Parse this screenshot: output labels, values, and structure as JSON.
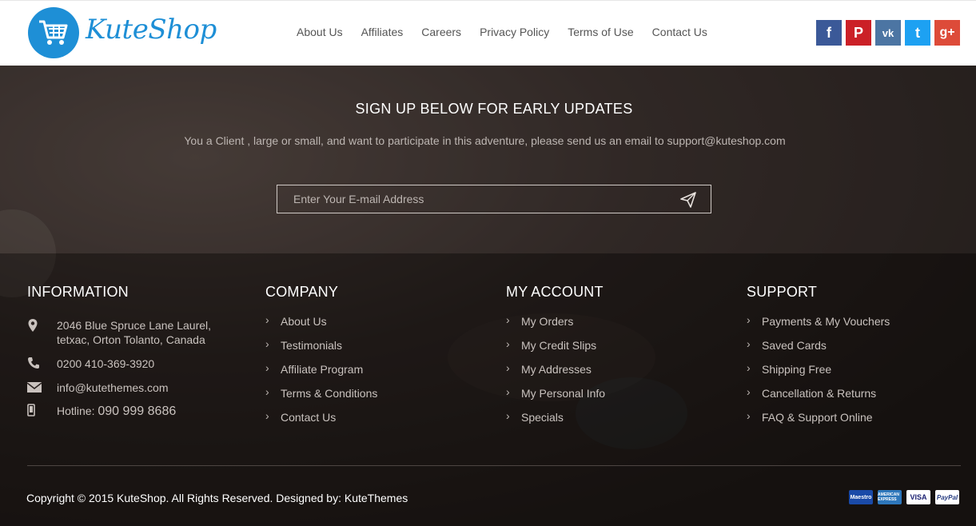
{
  "header": {
    "logo_text": "KuteShop",
    "nav": [
      "About Us",
      "Affiliates",
      "Careers",
      "Privacy Policy",
      "Terms of Use",
      "Contact Us"
    ],
    "social": [
      {
        "icon": "facebook-icon",
        "glyph": "f"
      },
      {
        "icon": "pinterest-icon",
        "glyph": "P"
      },
      {
        "icon": "vk-icon",
        "glyph": "vk"
      },
      {
        "icon": "twitter-icon",
        "glyph": "t"
      },
      {
        "icon": "google-plus-icon",
        "glyph": "g+"
      }
    ]
  },
  "signup": {
    "title": "SIGN UP BELOW FOR EARLY UPDATES",
    "text": "You a Client , large or small, and want to participate in this adventure, please send us an email to support@kuteshop.com",
    "placeholder": "Enter Your E-mail Address"
  },
  "footer": {
    "information": {
      "title": "INFORMATION",
      "address_line1": "2046 Blue Spruce Lane Laurel,",
      "address_line2": "tetxac, Orton Tolanto, Canada",
      "phone": "0200 410-369-3920",
      "email": "info@kutethemes.com",
      "hotline_label": "Hotline:",
      "hotline_number": "090 999 8686"
    },
    "company": {
      "title": "COMPANY",
      "links": [
        "About Us",
        "Testimonials",
        "Affiliate Program",
        "Terms & Conditions",
        "Contact Us"
      ]
    },
    "account": {
      "title": "MY ACCOUNT",
      "links": [
        "My Orders",
        "My Credit Slips",
        "My Addresses",
        "My Personal Info",
        "Specials"
      ]
    },
    "support": {
      "title": "SUPPORT",
      "links": [
        "Payments & My Vouchers",
        "Saved Cards",
        "Shipping Free",
        "Cancellation & Returns",
        "FAQ & Support Online"
      ]
    },
    "copyright": "Copyright © 2015 KuteShop. All Rights Reserved. Designed by: KuteThemes",
    "payments": [
      {
        "icon": "maestro-icon",
        "label": "Maestro"
      },
      {
        "icon": "amex-icon",
        "label": "AMERICAN EXPRESS"
      },
      {
        "icon": "visa-icon",
        "label": "VISA"
      },
      {
        "icon": "paypal-icon",
        "label": "PayPal"
      }
    ]
  },
  "colors": {
    "brand": "#1e8fd6",
    "footer_bg": "#1b1614"
  }
}
